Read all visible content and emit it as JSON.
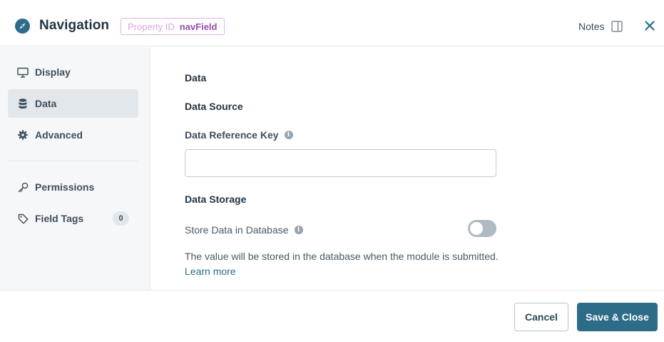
{
  "header": {
    "title": "Navigation",
    "property_id_key": "Property ID",
    "property_id_value": "navField",
    "notes_label": "Notes",
    "icon": "compass-icon"
  },
  "sidebar": {
    "items": [
      {
        "label": "Display",
        "icon": "monitor-icon",
        "active": false
      },
      {
        "label": "Data",
        "icon": "database-icon",
        "active": true
      },
      {
        "label": "Advanced",
        "icon": "gear-icon",
        "active": false
      },
      {
        "label": "Permissions",
        "icon": "key-icon",
        "active": false
      },
      {
        "label": "Field Tags",
        "icon": "tag-icon",
        "active": false,
        "badge": "0"
      }
    ]
  },
  "main": {
    "section_title": "Data",
    "data_source_title": "Data Source",
    "data_reference_key_label": "Data Reference Key",
    "data_reference_key_value": "",
    "data_storage_title": "Data Storage",
    "store_in_db_label": "Store Data in Database",
    "store_in_db_enabled": false,
    "help_text": "The value will be stored in the database when the module is submitted.",
    "learn_more": "Learn more"
  },
  "footer": {
    "cancel_label": "Cancel",
    "save_label": "Save & Close"
  },
  "colors": {
    "accent": "#2c6c88",
    "property_pill_border": "#e2b3ec",
    "property_pill_value": "#9a4bb0",
    "sidebar_bg": "#f6f7f9",
    "sidebar_active_bg": "#e2e7ec",
    "toggle_off": "#b0bac2"
  }
}
